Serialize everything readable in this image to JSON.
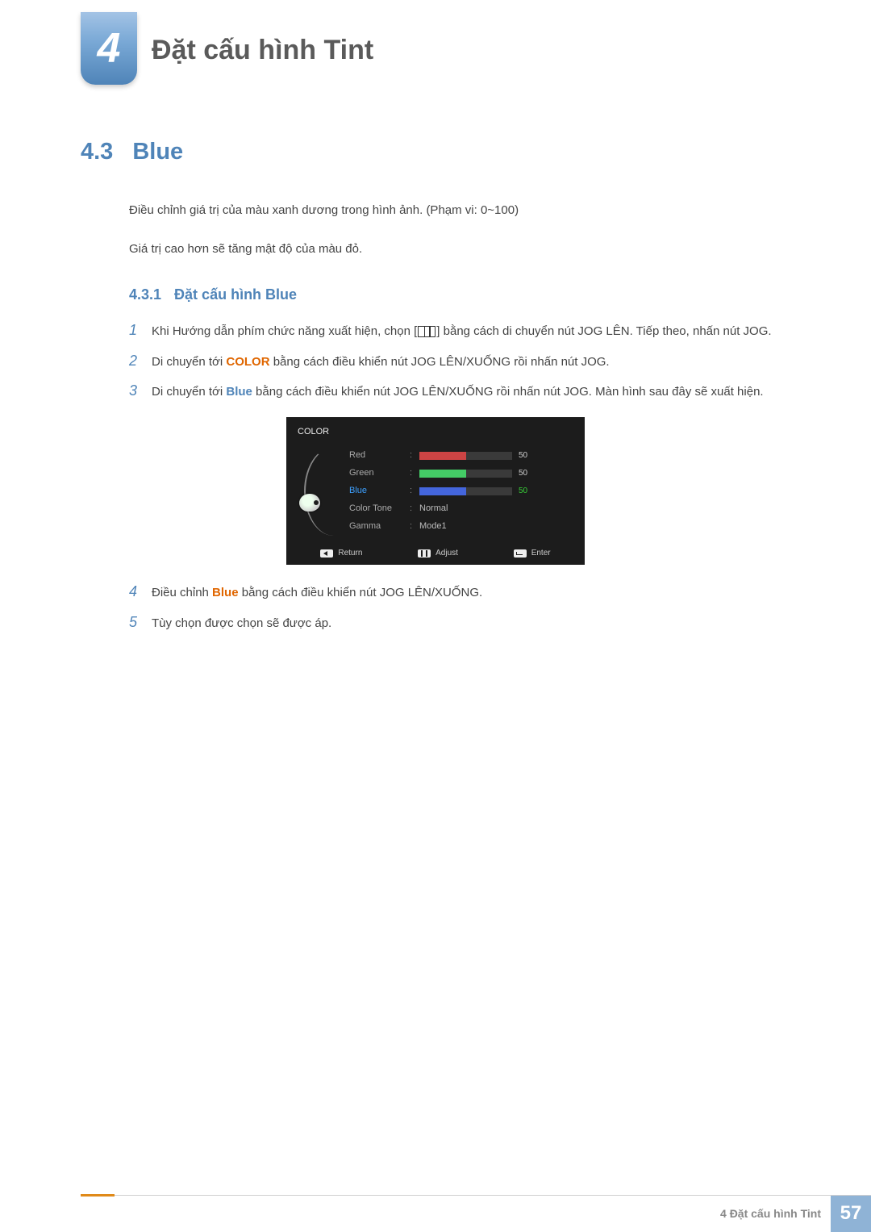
{
  "chapter": {
    "number": "4",
    "title": "Đặt cấu hình Tint"
  },
  "section": {
    "number": "4.3",
    "title": "Blue"
  },
  "intro": {
    "p1": "Điều chỉnh giá trị của màu xanh dương trong hình ảnh. (Phạm vi: 0~100)",
    "p2": "Giá trị cao hơn sẽ tăng mật độ của màu đỏ."
  },
  "subsection": {
    "number": "4.3.1",
    "title": "Đặt cấu hình Blue"
  },
  "steps": {
    "s1_a": "Khi Hướng dẫn phím chức năng xuất hiện, chọn [",
    "s1_b": "] bằng cách di chuyển nút JOG LÊN. Tiếp theo, nhấn nút JOG.",
    "s2_a": "Di chuyển tới ",
    "s2_kw": "COLOR",
    "s2_b": " bằng cách điều khiển nút JOG LÊN/XUỐNG rồi nhấn nút JOG.",
    "s3_a": "Di chuyển tới ",
    "s3_kw": "Blue",
    "s3_b": " bằng cách điều khiển nút JOG LÊN/XUỐNG rồi nhấn nút JOG. Màn hình sau đây sẽ xuất hiện.",
    "s4_a": "Điều chỉnh ",
    "s4_kw": "Blue",
    "s4_b": " bằng cách điều khiển nút JOG LÊN/XUỐNG.",
    "s5": "Tùy chọn được chọn sẽ được áp."
  },
  "osd": {
    "title": "COLOR",
    "rows": {
      "red": {
        "label": "Red",
        "value": "50",
        "pct": 50
      },
      "green": {
        "label": "Green",
        "value": "50",
        "pct": 50
      },
      "blue": {
        "label": "Blue",
        "value": "50",
        "pct": 50
      },
      "tone": {
        "label": "Color Tone",
        "value": "Normal"
      },
      "gamma": {
        "label": "Gamma",
        "value": "Mode1"
      }
    },
    "footer": {
      "return": "Return",
      "adjust": "Adjust",
      "enter": "Enter"
    }
  },
  "footer": {
    "label": "4 Đặt cấu hình Tint",
    "page": "57"
  }
}
